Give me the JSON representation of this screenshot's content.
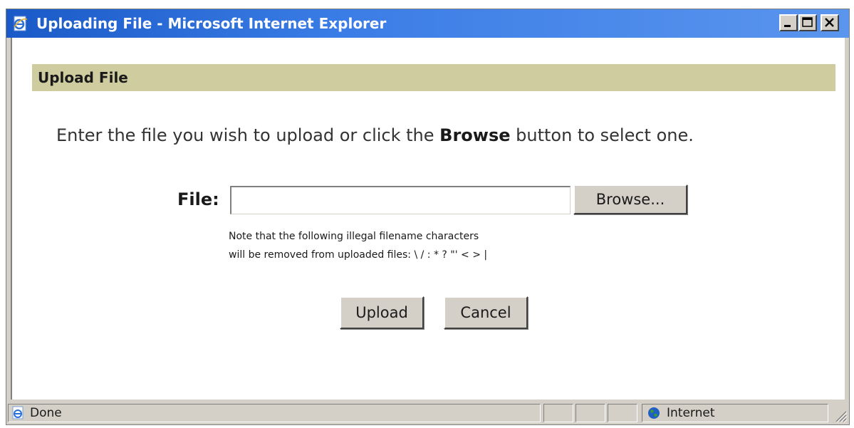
{
  "window": {
    "title": "Uploading File - Microsoft Internet Explorer",
    "icon": "ie-page-icon",
    "controls": {
      "minimize": "minimize-icon",
      "maximize": "maximize-icon",
      "close": "close-icon"
    }
  },
  "dialog": {
    "header": "Upload File",
    "instruction_before": "Enter the file you wish to upload or click the ",
    "instruction_bold": "Browse",
    "instruction_after": " button to select one.",
    "file_label": "File:",
    "file_input_value": "",
    "browse_label": "Browse...",
    "note_line1": "Note that the following illegal filename characters",
    "note_line2": "will be removed from uploaded files: \\ / : * ? \"' < > |",
    "upload_label": "Upload",
    "cancel_label": "Cancel"
  },
  "statusbar": {
    "status_text": "Done",
    "zone_text": "Internet",
    "status_icon": "ie-page-icon",
    "zone_icon": "globe-icon"
  },
  "colors": {
    "titlebar": "#1a5ac8",
    "header_band": "#cfcca0",
    "chrome": "#d4d0c8"
  }
}
